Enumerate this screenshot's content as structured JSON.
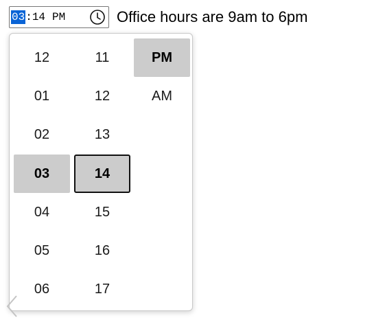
{
  "time_input": {
    "hour": "03",
    "separator": ":",
    "minute": "14",
    "period": "PM",
    "icon": "clock-icon"
  },
  "label": "Office hours are 9am to 6pm",
  "picker": {
    "hours": [
      "12",
      "01",
      "02",
      "03",
      "04",
      "05",
      "06"
    ],
    "minutes": [
      "11",
      "12",
      "13",
      "14",
      "15",
      "16",
      "17"
    ],
    "periods": [
      "PM",
      "AM"
    ],
    "selected_hour": "03",
    "selected_minute": "14",
    "selected_period": "PM"
  },
  "colors": {
    "segment_highlight": "#0a64d6",
    "selected_option": "#cccccc"
  }
}
